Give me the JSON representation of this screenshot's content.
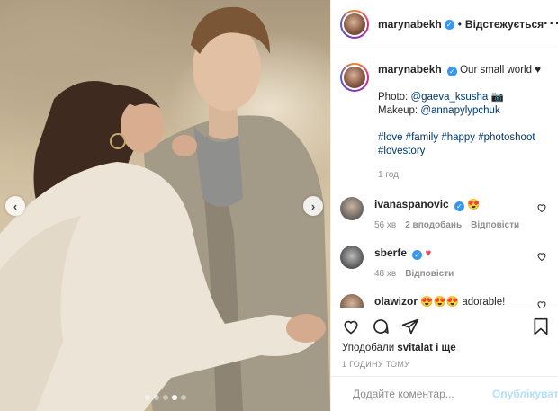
{
  "post": {
    "username": "marynabekh",
    "follow_status": "Відстежується",
    "more_icon": "more-horizontal-icon",
    "caption": {
      "title": "Our small world",
      "title_emoji": "♥",
      "photo_label": "Photo:",
      "photo_credit": "@gaeva_ksusha",
      "photo_emoji": "📷",
      "makeup_label": "Makeup:",
      "makeup_credit": "@annapylypchuk",
      "hashtags_line1": "#love #family #happy #photoshoot",
      "hashtags_line2": "#lovestory",
      "time": "1 год"
    },
    "comments": [
      {
        "username": "ivanaspanovic",
        "text": "😍",
        "time": "56 хв",
        "likes": "2 вподобань",
        "reply": "Відповісти"
      },
      {
        "username": "sberfe",
        "text": "♥",
        "time": "48 хв",
        "likes": "",
        "reply": "Відповісти"
      },
      {
        "username": "olawizor",
        "text": "😍😍😍 adorable!",
        "time": "",
        "likes": "",
        "reply": ""
      }
    ],
    "likes_prefix": "Уподобали",
    "likes_user": "svitalat",
    "likes_suffix": "і ще",
    "timestamp": "1 ГОДИНУ ТОМУ",
    "add_comment_placeholder": "Додайте коментар...",
    "publish_label": "Опублікувати",
    "carousel": {
      "total": 5,
      "active": 4
    }
  },
  "colors": {
    "link": "#00376b",
    "verified": "#3897f0",
    "muted": "#8e8e8e",
    "publish": "#b2dffc"
  }
}
